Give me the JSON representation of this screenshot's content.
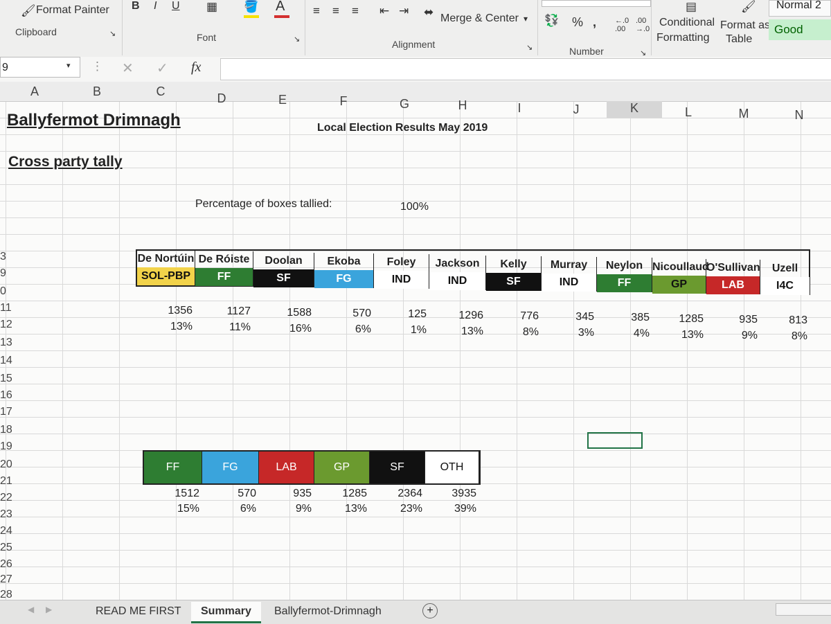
{
  "ribbon": {
    "format_painter": "Format Painter",
    "clipboard": "Clipboard",
    "font": "Font",
    "alignment": "Alignment",
    "merge_center": "Merge & Center",
    "number": "Number",
    "percent": "%",
    "comma": ",",
    "conditional1": "Conditional",
    "conditional2": "Formatting",
    "format_as1": "Format as",
    "format_as2": "Table",
    "style_normal2": "Normal 2",
    "style_good": "Good",
    "bold": "B",
    "italic": "I",
    "underline": "U"
  },
  "formula_bar": {
    "name_box": "9",
    "fx": "fx",
    "value": ""
  },
  "columns": [
    "A",
    "B",
    "C",
    "D",
    "E",
    "F",
    "G",
    "H",
    "I",
    "J",
    "K",
    "L",
    "M",
    "N"
  ],
  "rows": [
    "3",
    "9",
    "0",
    "11",
    "12",
    "13",
    "14",
    "15",
    "16",
    "17",
    "18",
    "19",
    "20",
    "21",
    "22",
    "23",
    "24",
    "25",
    "26",
    "27",
    "28"
  ],
  "sheet": {
    "title": "Ballyfermot Drimnagh",
    "subtitle": "Local Election Results May 2019",
    "section": "Cross party tally",
    "pct_label": "Percentage of boxes tallied:",
    "pct_value": "100%"
  },
  "candidates": [
    {
      "name": "De Nortúin",
      "party": "SOL-PBP",
      "votes": "1356",
      "pct": "13%",
      "color": "#f2d34a",
      "text": "#111"
    },
    {
      "name": "De Róiste",
      "party": "FF",
      "votes": "1127",
      "pct": "11%",
      "color": "#2e7d32",
      "text": "#ffffff"
    },
    {
      "name": "Doolan",
      "party": "SF",
      "votes": "1588",
      "pct": "16%",
      "color": "#111111",
      "text": "#ffffff"
    },
    {
      "name": "Ekoba",
      "party": "FG",
      "votes": "570",
      "pct": "6%",
      "color": "#3aa4dc",
      "text": "#ffffff"
    },
    {
      "name": "Foley",
      "party": "IND",
      "votes": "125",
      "pct": "1%",
      "color": "#ffffff",
      "text": "#111"
    },
    {
      "name": "Jackson",
      "party": "IND",
      "votes": "1296",
      "pct": "13%",
      "color": "#ffffff",
      "text": "#111"
    },
    {
      "name": "Kelly",
      "party": "SF",
      "votes": "776",
      "pct": "8%",
      "color": "#111111",
      "text": "#ffffff"
    },
    {
      "name": "Murray",
      "party": "IND",
      "votes": "345",
      "pct": "3%",
      "color": "#ffffff",
      "text": "#111"
    },
    {
      "name": "Neylon",
      "party": "FF",
      "votes": "385",
      "pct": "4%",
      "color": "#2e7d32",
      "text": "#ffffff"
    },
    {
      "name": "Nicoullaud",
      "party": "GP",
      "votes": "1285",
      "pct": "13%",
      "color": "#6b9a2f",
      "text": "#111"
    },
    {
      "name": "O'Sullivan",
      "party": "LAB",
      "votes": "935",
      "pct": "9%",
      "color": "#c62828",
      "text": "#ffffff"
    },
    {
      "name": "Uzell",
      "party": "I4C",
      "votes": "813",
      "pct": "8%",
      "color": "#ffffff",
      "text": "#111"
    }
  ],
  "party_totals": [
    {
      "party": "FF",
      "votes": "1512",
      "pct": "15%",
      "color": "#2e7d32",
      "text": "#ffffff"
    },
    {
      "party": "FG",
      "votes": "570",
      "pct": "6%",
      "color": "#3aa4dc",
      "text": "#ffffff"
    },
    {
      "party": "LAB",
      "votes": "935",
      "pct": "9%",
      "color": "#c62828",
      "text": "#ffffff"
    },
    {
      "party": "GP",
      "votes": "1285",
      "pct": "13%",
      "color": "#6b9a2f",
      "text": "#ffffff"
    },
    {
      "party": "SF",
      "votes": "2364",
      "pct": "23%",
      "color": "#111111",
      "text": "#ffffff"
    },
    {
      "party": "OTH",
      "votes": "3935",
      "pct": "39%",
      "color": "#ffffff",
      "text": "#111"
    }
  ],
  "tabs": [
    "READ ME FIRST",
    "Summary",
    "Ballyfermot-Drimnagh"
  ],
  "active_tab": "Summary",
  "add_sheet": "+"
}
